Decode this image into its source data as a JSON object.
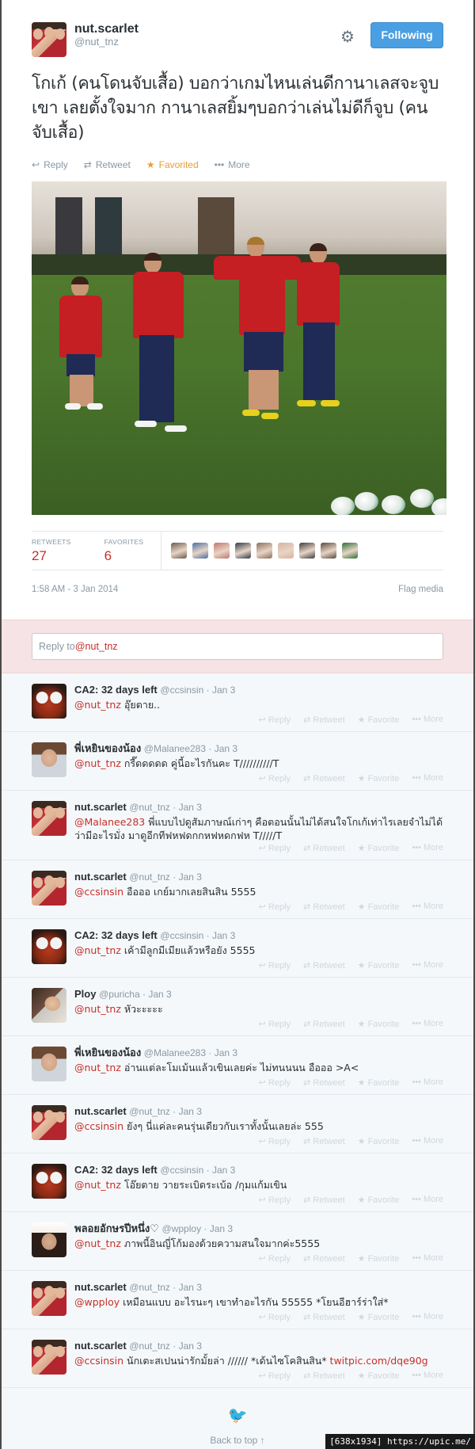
{
  "tweet": {
    "fullname": "nut.scarlet",
    "screen_name": "@nut_tnz",
    "follow_label": "Following",
    "text": "โกเก้ (คนโดนจับเสื้อ) บอกว่าเกมไหนเล่นดีกานาเลสจะจูบเขา เลยตั้งใจมาก กานาเลสยิ้มๆบอกว่าเล่นไม่ดีก็จูบ (คนจับเสื้อ)",
    "actions": {
      "reply": "Reply",
      "retweet": "Retweet",
      "favorited": "Favorited",
      "more": "More"
    },
    "stats": {
      "retweets_label": "RETWEETS",
      "retweets_count": "27",
      "favorites_label": "FAVORITES",
      "favorites_count": "6"
    },
    "favoriter_colors": [
      "#6b5b4d",
      "#4a6fa5",
      "#c2776b",
      "#2f3b46",
      "#8b6e5c",
      "#d9b2a0",
      "#3d3d3d",
      "#5a4a3c",
      "#2d6f3a"
    ],
    "timestamp": "1:58 AM - 3 Jan 2014",
    "flag_media": "Flag media"
  },
  "reply_box": {
    "prefix": "Reply to ",
    "mention": "@nut_tnz"
  },
  "reply_actions": {
    "reply": "Reply",
    "retweet": "Retweet",
    "favorite": "Favorite",
    "more": "More"
  },
  "replies": [
    {
      "name": "CA2: 32 days left",
      "screen": "@ccsinsin",
      "time": "Jan 3",
      "mention": "@nut_tnz",
      "text": " อุ๊ยตาย..",
      "avatar": "panda"
    },
    {
      "name": "พี่เหยินของน้อง",
      "screen": "@Malanee283",
      "time": "Jan 3",
      "mention": "@nut_tnz",
      "text": " กรี๊ดดดดด คู่นี้อะไรกันคะ T//////////T",
      "avatar": "man"
    },
    {
      "name": "nut.scarlet",
      "screen": "@nut_tnz",
      "time": "Jan 3",
      "mention": "@Malanee283",
      "text": " พี่แบบไปดูสัมภาษณ์เก่าๆ คือตอนนั้นไม่ได้สนใจโกเก้เท่าไรเลยจำไม่ได้ว่ามีอะไรมั่ง มาดูอีกทีฟหฟดกกหฟหดกฟห T/////T",
      "avatar": "team",
      "tall": true
    },
    {
      "name": "nut.scarlet",
      "screen": "@nut_tnz",
      "time": "Jan 3",
      "mention": "@ccsinsin",
      "text": " อือออ เกย์มากเลยสินสิน 5555",
      "avatar": "team"
    },
    {
      "name": "CA2: 32 days left",
      "screen": "@ccsinsin",
      "time": "Jan 3",
      "mention": "@nut_tnz",
      "text": " เค้ามีลูกมีเมียแล้วหรือยัง 5555",
      "avatar": "panda"
    },
    {
      "name": "Ploy",
      "screen": "@puricha",
      "time": "Jan 3",
      "mention": "@nut_tnz",
      "text": " หัวะะะะะ",
      "avatar": "girl"
    },
    {
      "name": "พี่เหยินของน้อง",
      "screen": "@Malanee283",
      "time": "Jan 3",
      "mention": "@nut_tnz",
      "text": " อ่านแต่ละโมเม้นแล้วเขินเลยค่ะ ไม่ทนนนน อือออ >A<",
      "avatar": "man"
    },
    {
      "name": "nut.scarlet",
      "screen": "@nut_tnz",
      "time": "Jan 3",
      "mention": "@ccsinsin",
      "text": " ยังๆ นี่แค่ละคนรุ่นเดียวกับเราทั้งนั้นเลยล่ะ 555",
      "avatar": "team"
    },
    {
      "name": "CA2: 32 days left",
      "screen": "@ccsinsin",
      "time": "Jan 3",
      "mention": "@nut_tnz",
      "text": " โอ๊ยตาย วายระเบิดระเบ้อ /กุมแก้มเขิน",
      "avatar": "panda"
    },
    {
      "name": "พลอยอักษรปีหนึ่ง♡",
      "screen": "@wpploy",
      "time": "Jan 3",
      "mention": "@nut_tnz",
      "text": " ภาพนี้อินญี่โก้มองด้วยความสนใจมากค่ะ5555",
      "avatar": "girl2"
    },
    {
      "name": "nut.scarlet",
      "screen": "@nut_tnz",
      "time": "Jan 3",
      "mention": "@wpploy",
      "text": " เหมือนแบบ อะไรนะๆ เขาทำอะไรกัน 55555 *โยนอีฮาร์ร่าใส่*",
      "avatar": "team"
    },
    {
      "name": "nut.scarlet",
      "screen": "@nut_tnz",
      "time": "Jan 3",
      "mention": "@ccsinsin",
      "text": " นักเตะสเปนน่ารักมั้ยล่า ////// *เด้นไซโคสินสิน* ",
      "link": "twitpic.com/dqe90g",
      "avatar": "team"
    }
  ],
  "footer": {
    "back_to_top": "Back to top ↑"
  },
  "watermark": "[638x1934] https://upic.me/"
}
